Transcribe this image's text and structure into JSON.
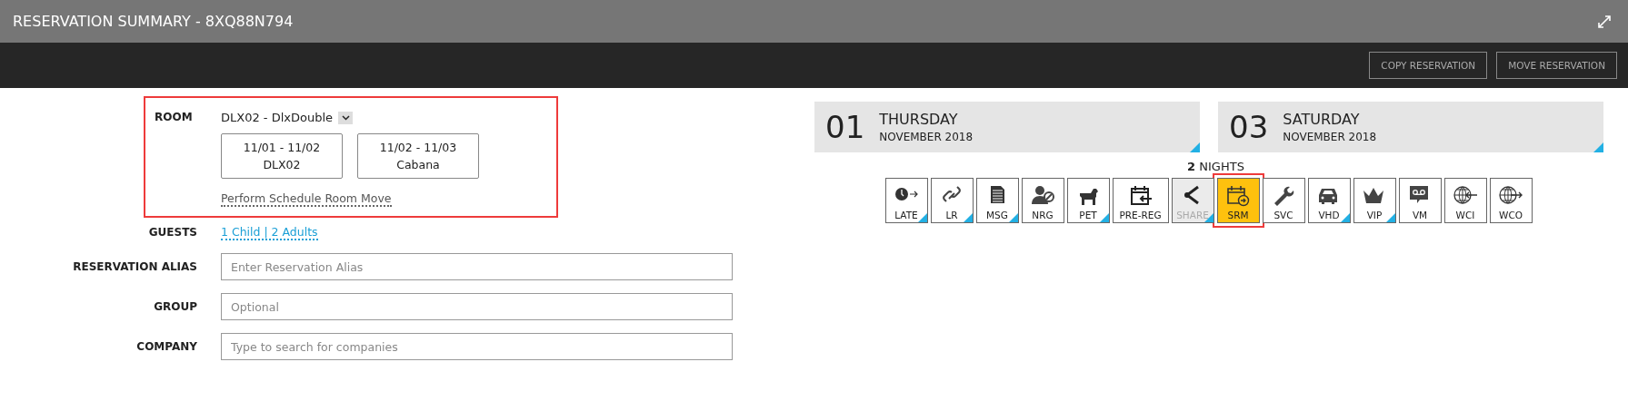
{
  "window": {
    "title": "RESERVATION SUMMARY - 8XQ88N794"
  },
  "toolbar": {
    "buttons": [
      "COPY RESERVATION",
      "MOVE RESERVATION"
    ]
  },
  "room": {
    "label": "ROOM",
    "highlighted": true,
    "value": "DLX02 - DlxDouble",
    "segments": [
      {
        "dates": "11/01 - 11/02",
        "room": "DLX02"
      },
      {
        "dates": "11/02 - 11/03",
        "room": "Cabana"
      }
    ],
    "link": "Perform Schedule Room Move"
  },
  "guests": {
    "label": "GUESTS",
    "value": "1 Child | 2 Adults"
  },
  "fields": [
    {
      "label": "RESERVATION ALIAS",
      "placeholder": "Enter Reservation Alias"
    },
    {
      "label": "GROUP",
      "placeholder": "Optional"
    },
    {
      "label": "COMPANY",
      "placeholder": "Type to search for companies"
    }
  ],
  "dates": [
    {
      "day": "01",
      "weekday": "THURSDAY",
      "month": "NOVEMBER 2018"
    },
    {
      "day": "03",
      "weekday": "SATURDAY",
      "month": "NOVEMBER 2018"
    }
  ],
  "nights": {
    "count": "2",
    "label": "NIGHTS"
  },
  "actions": [
    {
      "kind": "clock",
      "label": "LATE",
      "flagged": true,
      "selected": false,
      "disabled": false,
      "highlighted": false
    },
    {
      "kind": "link",
      "label": "LR",
      "flagged": true,
      "selected": false,
      "disabled": false,
      "highlighted": false
    },
    {
      "kind": "document",
      "label": "MSG",
      "flagged": true,
      "selected": false,
      "disabled": false,
      "highlighted": false
    },
    {
      "kind": "person",
      "label": "NRG",
      "flagged": false,
      "selected": false,
      "disabled": false,
      "highlighted": false
    },
    {
      "kind": "dog",
      "label": "PET",
      "flagged": true,
      "selected": false,
      "disabled": false,
      "highlighted": false
    },
    {
      "kind": "calendar-in",
      "label": "PRE-REG",
      "flagged": false,
      "selected": false,
      "disabled": false,
      "highlighted": false
    },
    {
      "kind": "share",
      "label": "SHARE",
      "flagged": true,
      "selected": false,
      "disabled": true,
      "highlighted": false
    },
    {
      "kind": "calendar-out",
      "label": "SRM",
      "flagged": false,
      "selected": true,
      "disabled": false,
      "highlighted": true
    },
    {
      "kind": "wrench",
      "label": "SVC",
      "flagged": false,
      "selected": false,
      "disabled": false,
      "highlighted": false
    },
    {
      "kind": "car",
      "label": "VHD",
      "flagged": true,
      "selected": false,
      "disabled": false,
      "highlighted": false
    },
    {
      "kind": "crown",
      "label": "VIP",
      "flagged": true,
      "selected": false,
      "disabled": false,
      "highlighted": false
    },
    {
      "kind": "voicemail",
      "label": "VM",
      "flagged": false,
      "selected": false,
      "disabled": false,
      "highlighted": false
    },
    {
      "kind": "globe-in",
      "label": "WCI",
      "flagged": false,
      "selected": false,
      "disabled": false,
      "highlighted": false
    },
    {
      "kind": "globe-out",
      "label": "WCO",
      "flagged": false,
      "selected": false,
      "disabled": false,
      "highlighted": false
    }
  ]
}
